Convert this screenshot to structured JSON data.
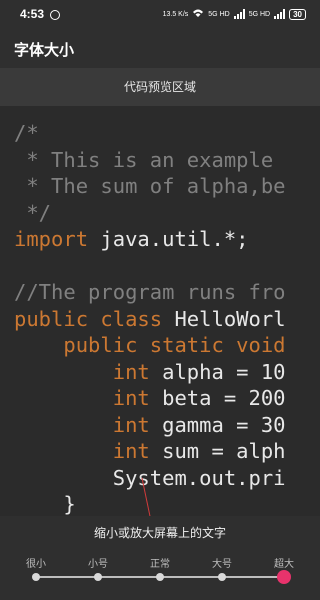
{
  "status": {
    "time": "4:53",
    "network1": "13.5 K/s",
    "network2": "5G HD",
    "network3": "5G HD",
    "battery": "30"
  },
  "appbar": {
    "title": "字体大小"
  },
  "preview": {
    "header": "代码预览区域"
  },
  "code": {
    "l1": "/*",
    "l2": " * This is an example",
    "l3": " * The sum of alpha,be",
    "l4": " */",
    "l5_kw": "import",
    "l5_rest": " java.util.*;",
    "l7": "//The program runs fro",
    "l8_kw": "public class",
    "l8_rest": " HelloWorl",
    "l9_kw": "    public static void",
    "l10_kw": "        int",
    "l10_rest": " alpha = 10",
    "l11_kw": "        int",
    "l11_rest": " beta = 200",
    "l12_kw": "        int",
    "l12_rest": " gamma = 30",
    "l13_kw": "        int",
    "l13_rest": " sum = alph",
    "l14": "        System.out.pri",
    "l15": "    }"
  },
  "font_size_panel": {
    "title": "缩小或放大屏幕上的文字",
    "levels": [
      "很小",
      "小号",
      "正常",
      "大号",
      "超大"
    ],
    "selected_level": "超大",
    "selected_index": 4,
    "accent_color": "#e8336c"
  }
}
